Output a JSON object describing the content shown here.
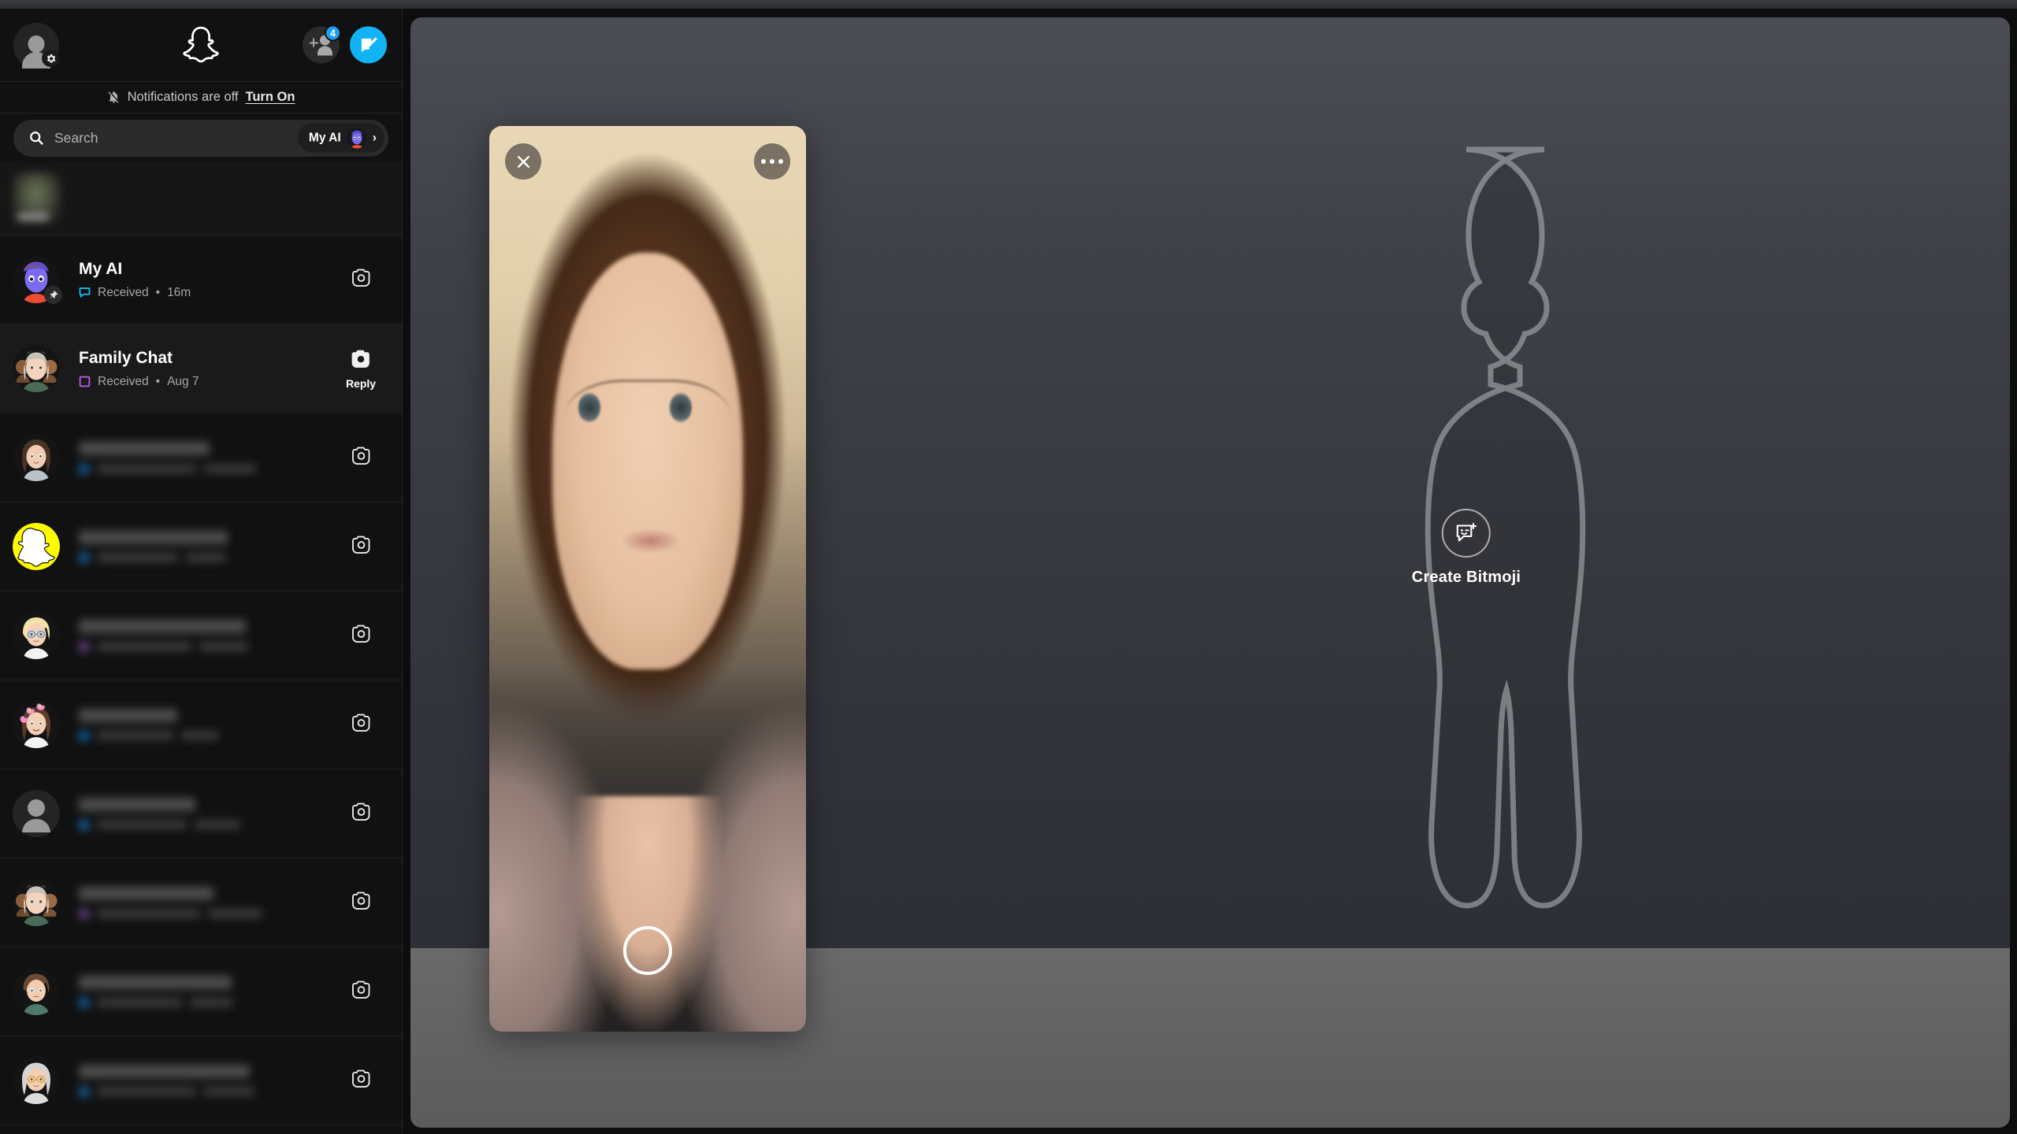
{
  "window": {
    "title": "Snapchat"
  },
  "sidebar": {
    "topbar": {
      "profile_avatar_name": "profile-avatar",
      "settings_icon": "gear-icon",
      "logo_icon": "snapchat-ghost-logo",
      "add_friends_icon": "add-friend-icon",
      "add_friends_badge": "4",
      "new_chat_icon": "new-chat-icon"
    },
    "notifications": {
      "icon": "bell-off-icon",
      "text": "Notifications are off",
      "action_label": "Turn On"
    },
    "search": {
      "icon": "search-icon",
      "placeholder": "Search",
      "value": "",
      "my_ai_label": "My AI",
      "my_ai_chevron": "chevron-right-icon"
    },
    "story_strip": {
      "label": ""
    },
    "chats": [
      {
        "name": "My AI",
        "status_icon": "chat-received-icon",
        "status": "Received",
        "separator": "•",
        "time": "16m",
        "action_icon": "camera-icon",
        "action_label": "",
        "pinned": true,
        "redacted": false,
        "avatar_kind": "myai",
        "active": false
      },
      {
        "name": "Family Chat",
        "status_icon": "snap-received-icon",
        "status": "Received",
        "separator": "•",
        "time": "Aug 7",
        "action_icon": "camera-icon-filled",
        "action_label": "Reply",
        "pinned": false,
        "redacted": false,
        "avatar_kind": "group",
        "active": true
      },
      {
        "name": "",
        "status": "",
        "time": "",
        "action_icon": "camera-icon",
        "action_label": "",
        "pinned": false,
        "redacted": true,
        "avatar_kind": "brunette",
        "active": false
      },
      {
        "name": "",
        "status": "",
        "time": "",
        "action_icon": "camera-icon",
        "action_label": "",
        "pinned": false,
        "redacted": true,
        "avatar_kind": "ghost-yellow",
        "active": false
      },
      {
        "name": "",
        "status": "",
        "time": "",
        "action_icon": "camera-icon",
        "action_label": "",
        "pinned": false,
        "redacted": true,
        "avatar_kind": "blonde",
        "active": false
      },
      {
        "name": "",
        "status": "",
        "time": "",
        "action_icon": "camera-icon",
        "action_label": "",
        "pinned": false,
        "redacted": true,
        "avatar_kind": "flowercrown",
        "active": false
      },
      {
        "name": "",
        "status": "",
        "time": "",
        "action_icon": "camera-icon",
        "action_label": "",
        "pinned": false,
        "redacted": true,
        "avatar_kind": "silhouette",
        "active": false
      },
      {
        "name": "",
        "status": "",
        "time": "",
        "action_icon": "camera-icon",
        "action_label": "",
        "pinned": false,
        "redacted": true,
        "avatar_kind": "group",
        "active": false
      },
      {
        "name": "",
        "status": "",
        "time": "",
        "action_icon": "camera-icon",
        "action_label": "",
        "pinned": false,
        "redacted": true,
        "avatar_kind": "shorthair",
        "active": false
      },
      {
        "name": "",
        "status": "",
        "time": "",
        "action_icon": "camera-icon",
        "action_label": "",
        "pinned": false,
        "redacted": true,
        "avatar_kind": "grayhair",
        "active": false
      }
    ]
  },
  "stage": {
    "camera": {
      "close_icon": "close-icon",
      "more_icon": "more-options-icon",
      "shutter_icon": "shutter-button"
    },
    "bitmoji": {
      "placeholder_icon": "bitmoji-silhouette",
      "create_icon": "bitmoji-face-plus-icon",
      "create_label": "Create Bitmoji"
    }
  },
  "colors": {
    "accent_blue": "#12b3f5",
    "chat_blue": "#19baf7",
    "snap_purple": "#c15cf7",
    "snap_yellow": "#FFFC00",
    "sidebar_bg": "#111111",
    "row_active": "#1a1a1a"
  }
}
